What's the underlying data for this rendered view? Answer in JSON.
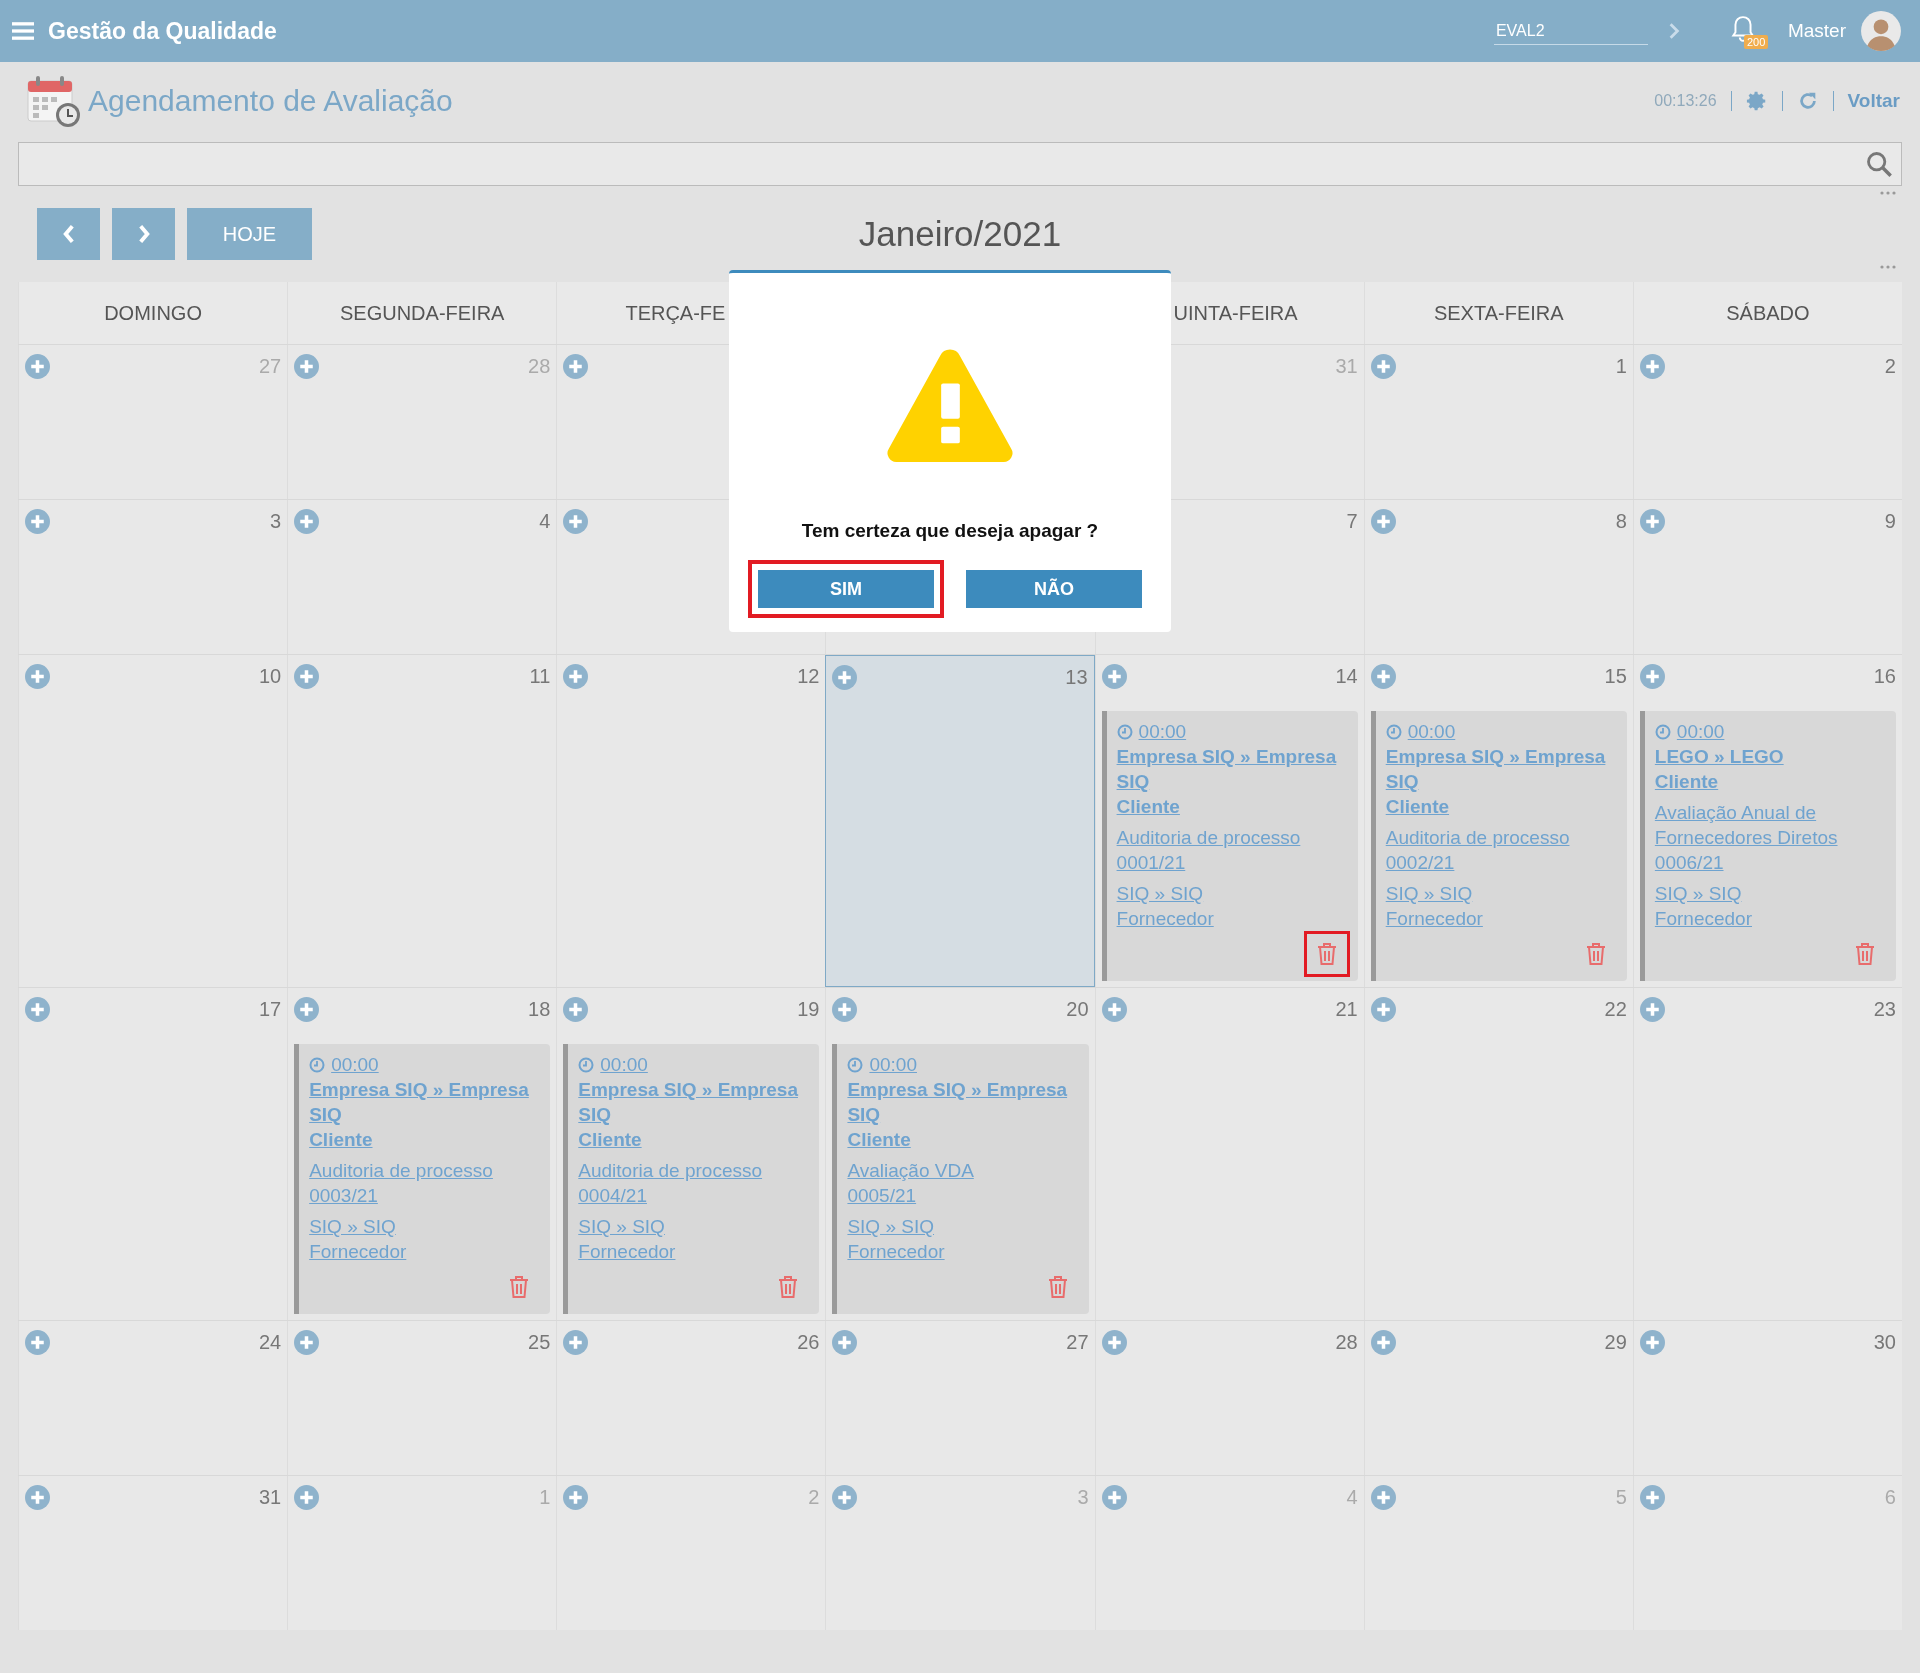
{
  "topbar": {
    "title": "Gestão da Qualidade",
    "environment": "EVAL2",
    "notifications": "200",
    "user": "Master"
  },
  "page": {
    "title": "Agendamento de Avaliação",
    "timer": "00:13:26",
    "back": "Voltar"
  },
  "calendar": {
    "today_button": "HOJE",
    "month": "Janeiro/2021",
    "columns": [
      {
        "label": "DOMINGO"
      },
      {
        "label": "SEGUNDA-FEIRA"
      },
      {
        "label": "TERÇA-FE"
      },
      {},
      {
        "label": "UINTA-FEIRA"
      },
      {
        "label": "SEXTA-FEIRA"
      },
      {
        "label": "SÁBADO"
      }
    ],
    "weeks": [
      {
        "days": [
          {
            "number": "27",
            "other_month": true,
            "add": true,
            "today": false
          },
          {
            "number": "28",
            "other_month": true,
            "add": true,
            "today": false
          },
          {
            "add": true,
            "today": false
          },
          {
            "number": "31",
            "other_month": true,
            "today": false
          },
          {
            "number": "1",
            "other_month": false,
            "add": true,
            "today": false
          },
          {
            "number": "2",
            "other_month": false,
            "add": true,
            "today": false
          }
        ]
      },
      {
        "days": [
          {
            "number": "3",
            "other_month": false,
            "add": true,
            "today": false
          },
          {
            "number": "4",
            "other_month": false,
            "add": true,
            "today": false
          },
          {
            "add": true,
            "today": false
          },
          {
            "number": "7",
            "other_month": false,
            "today": false
          },
          {
            "number": "8",
            "other_month": false,
            "add": true,
            "today": false
          },
          {
            "number": "9",
            "other_month": false,
            "add": true,
            "today": false
          }
        ]
      },
      {
        "days": [
          {
            "number": "10",
            "other_month": false,
            "add": true,
            "today": false
          },
          {
            "number": "11",
            "other_month": false,
            "add": true,
            "today": false
          },
          {
            "number": "12",
            "other_month": false,
            "add": true,
            "today": false
          },
          {
            "number": "13",
            "other_month": false,
            "add": true,
            "today": true
          },
          {
            "number": "14",
            "other_month": false,
            "add": true,
            "today": false,
            "events": [
              {
                "time": "00:00",
                "company": "Empresa SIQ » Empresa SIQ",
                "company_type": "Cliente",
                "title": "Auditoria de processo",
                "code": "0001/21",
                "supplier": "SIQ » SIQ",
                "supplier_type": "Fornecedor",
                "delete_highlighted": true
              }
            ]
          },
          {
            "number": "15",
            "other_month": false,
            "add": true,
            "today": false,
            "events": [
              {
                "time": "00:00",
                "company": "Empresa SIQ » Empresa SIQ",
                "company_type": "Cliente",
                "title": "Auditoria de processo",
                "code": "0002/21",
                "supplier": "SIQ » SIQ",
                "supplier_type": "Fornecedor",
                "delete_highlighted": false
              }
            ]
          },
          {
            "number": "16",
            "other_month": false,
            "add": true,
            "today": false,
            "events": [
              {
                "time": "00:00",
                "company": "LEGO » LEGO",
                "company_type": "Cliente",
                "title": "Avaliação Anual de Fornecedores Diretos",
                "code": "0006/21",
                "supplier": "SIQ » SIQ",
                "supplier_type": "Fornecedor",
                "delete_highlighted": false
              }
            ]
          }
        ]
      },
      {
        "days": [
          {
            "number": "17",
            "other_month": false,
            "add": true,
            "today": false
          },
          {
            "number": "18",
            "other_month": false,
            "add": true,
            "today": false,
            "events": [
              {
                "time": "00:00",
                "company": "Empresa SIQ » Empresa SIQ",
                "company_type": "Cliente",
                "title": "Auditoria de processo",
                "code": "0003/21",
                "supplier": "SIQ » SIQ",
                "supplier_type": "Fornecedor",
                "delete_highlighted": false
              }
            ]
          },
          {
            "number": "19",
            "other_month": false,
            "add": true,
            "today": false,
            "events": [
              {
                "time": "00:00",
                "company": "Empresa SIQ » Empresa SIQ",
                "company_type": "Cliente",
                "title": "Auditoria de processo",
                "code": "0004/21",
                "supplier": "SIQ » SIQ",
                "supplier_type": "Fornecedor",
                "delete_highlighted": false
              }
            ]
          },
          {
            "number": "20",
            "other_month": false,
            "add": true,
            "today": false,
            "events": [
              {
                "time": "00:00",
                "company": "Empresa SIQ » Empresa SIQ",
                "company_type": "Cliente",
                "title": "Avaliação VDA",
                "code": "0005/21",
                "supplier": "SIQ » SIQ",
                "supplier_type": "Fornecedor",
                "delete_highlighted": false
              }
            ]
          },
          {
            "number": "21",
            "other_month": false,
            "add": true,
            "today": false
          },
          {
            "number": "22",
            "other_month": false,
            "add": true,
            "today": false
          },
          {
            "number": "23",
            "other_month": false,
            "add": true,
            "today": false
          }
        ]
      },
      {
        "days": [
          {
            "number": "24",
            "other_month": false,
            "add": true,
            "today": false
          },
          {
            "number": "25",
            "other_month": false,
            "add": true,
            "today": false
          },
          {
            "number": "26",
            "other_month": false,
            "add": true,
            "today": false
          },
          {
            "number": "27",
            "other_month": false,
            "add": true,
            "today": false
          },
          {
            "number": "28",
            "other_month": false,
            "add": true,
            "today": false
          },
          {
            "number": "29",
            "other_month": false,
            "add": true,
            "today": false
          },
          {
            "number": "30",
            "other_month": false,
            "add": true,
            "today": false
          }
        ]
      },
      {
        "days": [
          {
            "number": "31",
            "other_month": false,
            "add": true,
            "today": false
          },
          {
            "number": "1",
            "other_month": true,
            "add": true,
            "today": false
          },
          {
            "number": "2",
            "other_month": true,
            "add": true,
            "today": false
          },
          {
            "number": "3",
            "other_month": true,
            "add": true,
            "today": false
          },
          {
            "number": "4",
            "other_month": true,
            "add": true,
            "today": false
          },
          {
            "number": "5",
            "other_month": true,
            "add": true,
            "today": false
          },
          {
            "number": "6",
            "other_month": true,
            "add": true,
            "today": false
          }
        ]
      }
    ]
  },
  "dialog": {
    "message": "Tem certeza que deseja apagar ?",
    "buttons": [
      {
        "label": "SIM",
        "highlighted": true
      },
      {
        "label": "NÃO",
        "highlighted": false
      }
    ]
  }
}
